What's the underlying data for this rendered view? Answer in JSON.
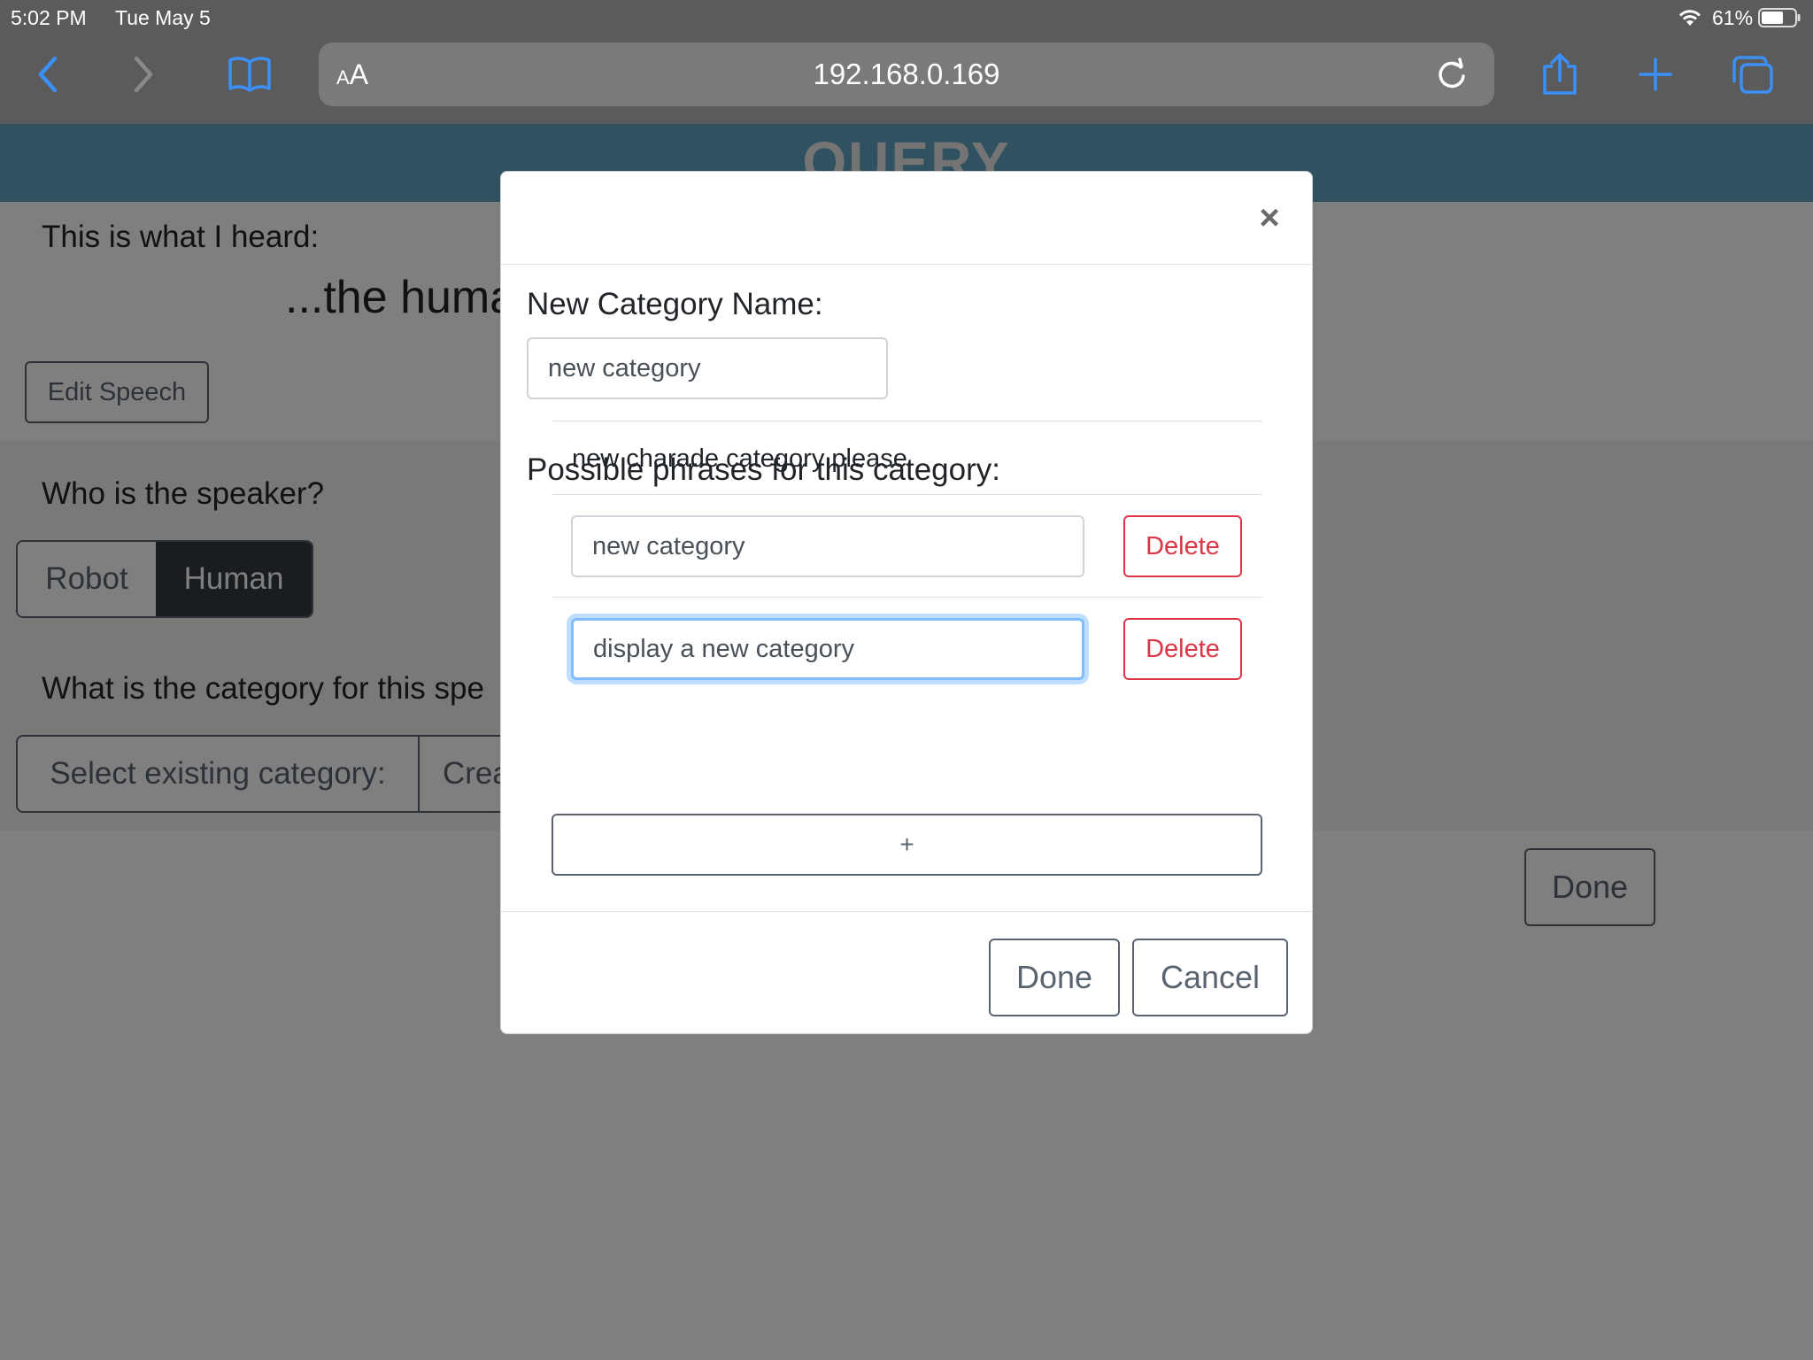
{
  "status_bar": {
    "time": "5:02 PM",
    "date": "Tue May 5",
    "battery": "61%"
  },
  "browser": {
    "text_size_label_small": "A",
    "text_size_label_large": "A",
    "url": "192.168.0.169",
    "icons": {
      "back": "chevron-left-icon",
      "forward": "chevron-right-icon",
      "bookmarks": "book-icon",
      "reload": "reload-icon",
      "share": "share-icon",
      "new_tab": "plus-icon",
      "tabs": "tabs-icon"
    },
    "accent_color": "#3b8ff6"
  },
  "page": {
    "header_title": "QUERY",
    "heard_label": "This is what I heard:",
    "heard_text": "...the huma",
    "edit_speech_button": "Edit Speech",
    "speaker_question": "Who is the speaker?",
    "speaker_options": [
      "Robot",
      "Human"
    ],
    "speaker_selected": "Human",
    "category_question": "What is the category for this spe",
    "category_options": [
      "Select existing category:",
      "Crea"
    ],
    "done_button": "Done"
  },
  "modal": {
    "close_symbol": "×",
    "name_label": "New Category Name:",
    "name_value": "new category",
    "phrases_label": "Possible phrases for this category:",
    "phrases": [
      {
        "text": "new charade category please",
        "editable": false
      },
      {
        "text": "new category",
        "editable": true,
        "delete_label": "Delete"
      },
      {
        "text": "display a new category",
        "editable": true,
        "focused": true,
        "delete_label": "Delete"
      }
    ],
    "add_button": "+",
    "done_button": "Done",
    "cancel_button": "Cancel",
    "danger_color": "#dc3545",
    "focus_color": "#80bdff"
  }
}
